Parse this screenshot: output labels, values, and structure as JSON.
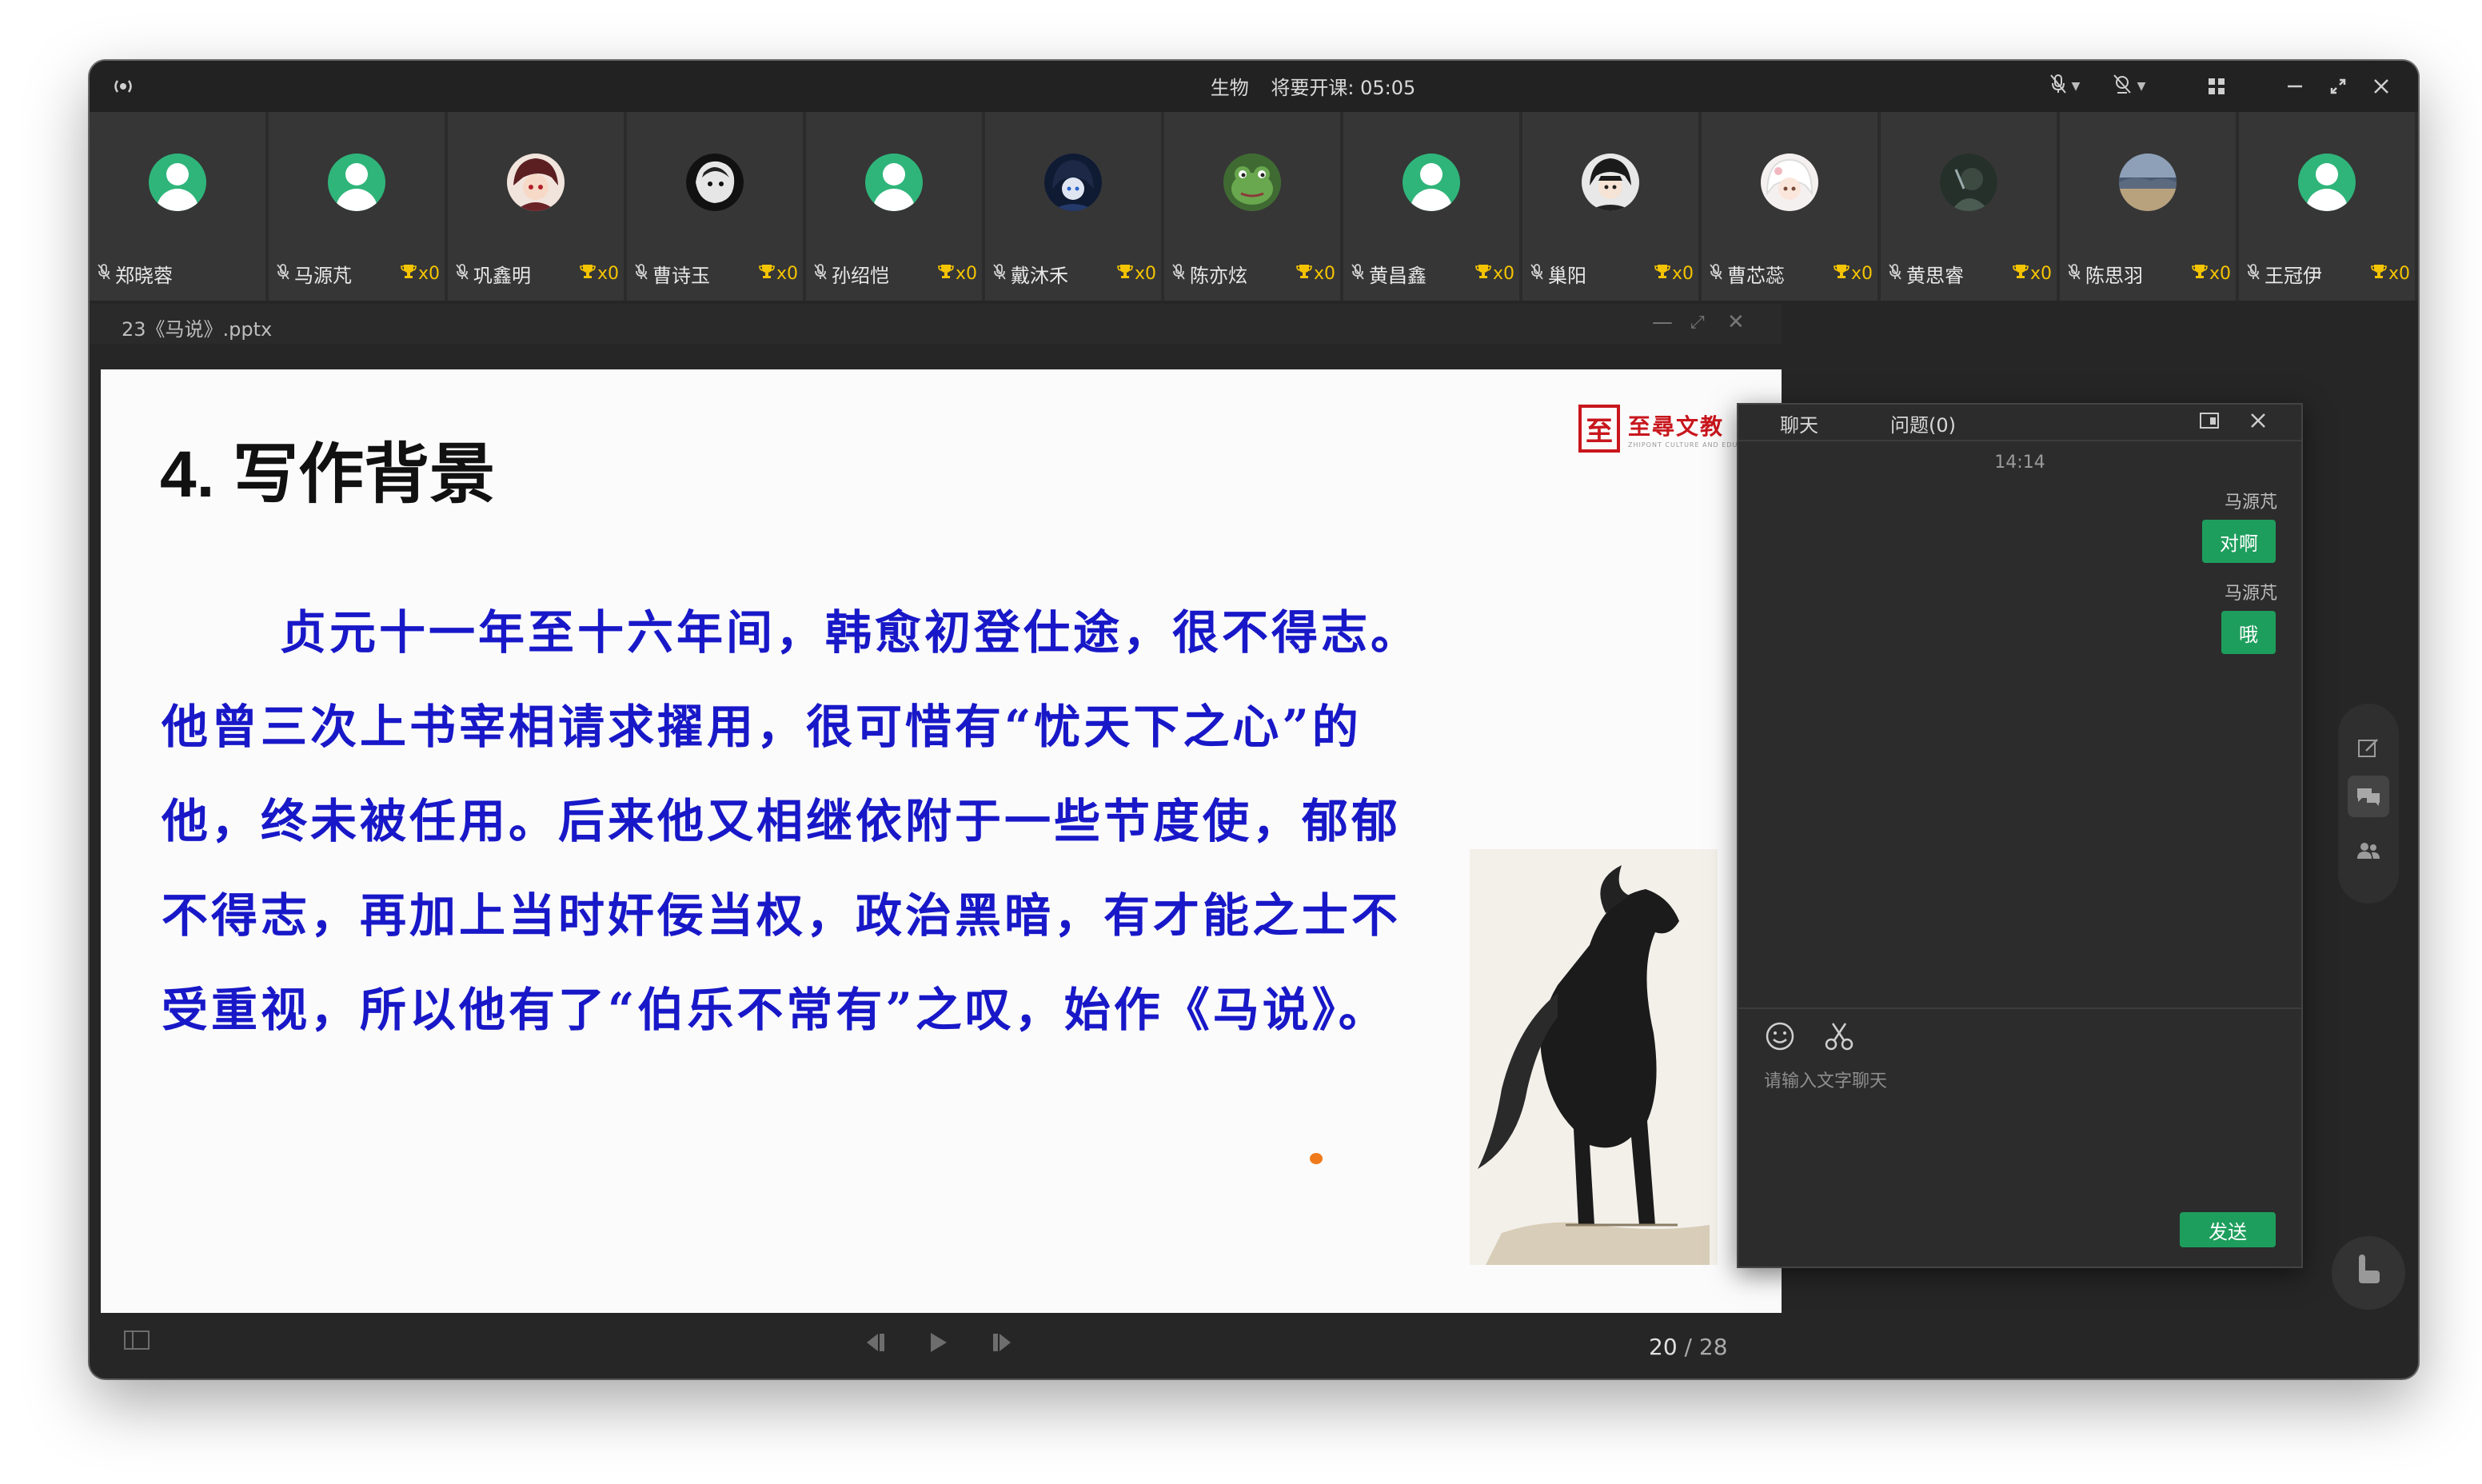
{
  "titlebar": {
    "subject": "生物",
    "status": "将要开课: 05:05"
  },
  "participants": [
    {
      "name": "郑晓蓉",
      "count": "",
      "avatar": "default"
    },
    {
      "name": "马源芃",
      "count": "x0",
      "avatar": "default"
    },
    {
      "name": "巩鑫明",
      "count": "x0",
      "avatar": "anime-red"
    },
    {
      "name": "曹诗玉",
      "count": "x0",
      "avatar": "mono"
    },
    {
      "name": "孙绍恺",
      "count": "x0",
      "avatar": "default"
    },
    {
      "name": "戴沐禾",
      "count": "x0",
      "avatar": "anime-blue"
    },
    {
      "name": "陈亦炫",
      "count": "x0",
      "avatar": "frog"
    },
    {
      "name": "黄昌鑫",
      "count": "x0",
      "avatar": "default"
    },
    {
      "name": "巢阳",
      "count": "x0",
      "avatar": "anime-dark"
    },
    {
      "name": "曹芯蕊",
      "count": "x0",
      "avatar": "girl"
    },
    {
      "name": "黄思睿",
      "count": "x0",
      "avatar": "dark-photo"
    },
    {
      "name": "陈思羽",
      "count": "x0",
      "avatar": "landscape"
    },
    {
      "name": "王冠伊",
      "count": "x0",
      "avatar": "default"
    }
  ],
  "document": {
    "filename": "23《马说》.pptx"
  },
  "slide": {
    "heading": "4. 写作背景",
    "body": "贞元十一年至十六年间，韩愈初登仕途，很不得志。他曾三次上书宰相请求擢用，很可惜有“忧天下之心”的他，终未被任用。后来他又相继依附于一些节度使，郁郁不得志，再加上当时奸佞当权，政治黑暗，有才能之士不受重视，所以他有了“伯乐不常有”之叹，始作《马说》。",
    "logo_char": "至",
    "logo_text": "至尋文教",
    "logo_sub": "ZHIPONT CULTURE AND EDUCATION"
  },
  "pager": {
    "current": "20",
    "separator": "/",
    "total": "28"
  },
  "chat": {
    "tab_chat": "聊天",
    "tab_questions": "问题(0)",
    "time": "14:14",
    "messages": [
      {
        "sender": "马源芃",
        "text": "对啊"
      },
      {
        "sender": "马源芃",
        "text": "哦"
      }
    ],
    "placeholder": "请输入文字聊天",
    "send_label": "发送"
  },
  "colors": {
    "accent": "#1e9e5d",
    "slide_text": "#1818c8",
    "logo_red": "#c8161d",
    "trophy": "#f5c400"
  }
}
